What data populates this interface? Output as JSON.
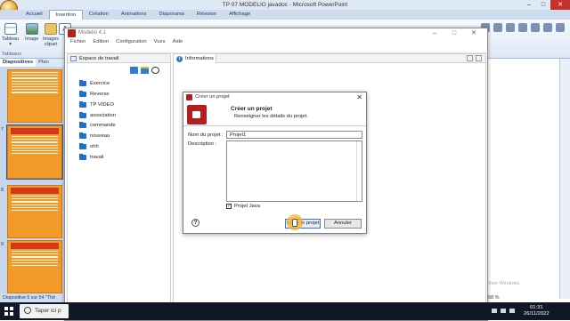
{
  "powerpoint": {
    "window_title": "TP 07 MODELIO javadoc - Microsoft PowerPoint",
    "tabs": [
      "Accueil",
      "Insertion",
      "Création",
      "Animations",
      "Diaporama",
      "Révision",
      "Affichage"
    ],
    "active_tab": "Insertion",
    "ribbon": {
      "buttons": [
        {
          "label": "Tableau",
          "sub": "▾"
        },
        {
          "label": "Image",
          "sub": ""
        },
        {
          "label": "Images",
          "sub": "clipart"
        },
        {
          "label": "A",
          "sub": ""
        }
      ],
      "group_label": "Tableaux"
    },
    "slides_tabs": [
      "Diapositives",
      "Plan"
    ],
    "slide_numbers": [
      "7",
      "8",
      "9"
    ],
    "status_text": "Diapositive 6 sur 54",
    "status_theme": "\"Thè",
    "zoom": "68 %"
  },
  "modelio": {
    "window_title": "Modelio 4.1",
    "menu": [
      "Fichier",
      "Edition",
      "Configuration",
      "Vues",
      "Aide"
    ],
    "workspace_title": "Espace de travail",
    "projects": [
      "Exercice",
      "Reverse",
      "TP VIDEO",
      "association",
      "commande",
      "nouveau",
      "ohh",
      "travail"
    ],
    "info_tab": "Informations",
    "info_icon_letter": "i"
  },
  "dialog": {
    "title": "Créer un projet",
    "header": "Créer un projet",
    "subheader": "Renseigner les détails du projet.",
    "name_label": "Nom du projet :",
    "name_value": "Projet1",
    "description_label": "Description :",
    "java_label": "Projet Java",
    "java_checked": "✓",
    "help": "?",
    "create_button": "Créer le projet",
    "cancel_button": "Annuler"
  },
  "windows": {
    "activate_title": "Activer Windows",
    "activate_sub": "Accédez aux paramètres pour activer Windows.",
    "search_placeholder": "Taper ici p",
    "time": "01:31",
    "date": "26/11/2022"
  },
  "colors": {
    "accent": "#3a78c2",
    "modelio_red": "#b31e1e",
    "folder_blue": "#1f6fd1",
    "slide_orange": "#f29a2a"
  }
}
